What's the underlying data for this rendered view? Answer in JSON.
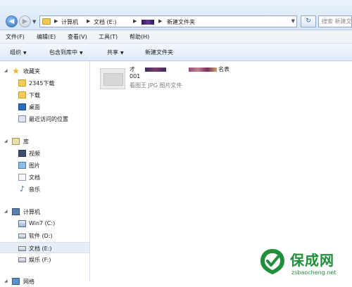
{
  "address_bar": {
    "breadcrumbs": [
      "计算机",
      "文档 (E:)",
      "新建文件夹"
    ],
    "search_placeholder": "搜索 新建文件夹"
  },
  "menu": [
    "文件(F)",
    "编辑(E)",
    "查看(V)",
    "工具(T)",
    "帮助(H)"
  ],
  "command_bar": {
    "organize": "组织",
    "include_in_library": "包含到库中",
    "share": "共享",
    "new_folder": "新建文件夹"
  },
  "nav_pane": {
    "favorites": {
      "label": "收藏夹",
      "items": [
        "2345下载",
        "下载",
        "桌面",
        "最近访问的位置"
      ]
    },
    "libraries": {
      "label": "库",
      "items": [
        "视频",
        "图片",
        "文档",
        "音乐"
      ]
    },
    "computer": {
      "label": "计算机",
      "items": [
        "Win7 (C:)",
        "软件 (D:)",
        "文档 (E:)",
        "娱乐 (F:)"
      ],
      "selected": "文档 (E:)"
    },
    "network": {
      "label": "网络"
    }
  },
  "content": {
    "file": {
      "name_line1_start": "才",
      "name_line1_end": "名表",
      "name_line2": "001",
      "type": "看图王 JPG 图片文件"
    }
  },
  "watermark": {
    "brand": "保成网",
    "url": "zsbaocheng.net"
  },
  "colors": {
    "accent": "#2b6fc4",
    "watermark": "#1f8f3a"
  }
}
